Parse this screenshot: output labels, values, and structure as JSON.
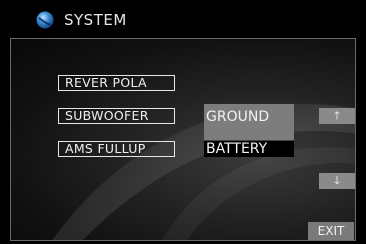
{
  "header": {
    "title": "SYSTEM",
    "icon": "globe-icon"
  },
  "menu": {
    "items": [
      {
        "label": "REVER POLA"
      },
      {
        "label": "SUBWOOFER"
      },
      {
        "label": "AMS FULLUP"
      }
    ]
  },
  "options": {
    "items": [
      {
        "label": "GROUND"
      },
      {
        "label": "BATTERY"
      }
    ]
  },
  "controls": {
    "up_icon": "arrow-up-icon",
    "down_icon": "arrow-down-icon",
    "up_glyph": "🡑",
    "down_glyph": "🡓",
    "exit_label": "EXIT"
  },
  "colors": {
    "background": "#000000",
    "text": "#f0f0f0",
    "highlight": "#7d7d7d",
    "button": "#8a8a8a"
  }
}
